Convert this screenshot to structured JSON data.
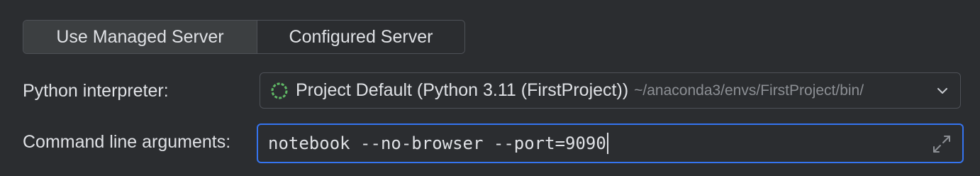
{
  "server_mode": {
    "options": [
      "Use Managed Server",
      "Configured Server"
    ],
    "selected": "Use Managed Server"
  },
  "interpreter": {
    "label": "Python interpreter:",
    "value": "Project Default (Python 3.11 (FirstProject))",
    "path": "~/anaconda3/envs/FirstProject/bin/",
    "icon": "python-env-icon"
  },
  "arguments": {
    "label": "Command line arguments:",
    "value": "notebook --no-browser --port=9090"
  },
  "colors": {
    "background": "#2b2d30",
    "focus_border": "#3574f0",
    "interpreter_icon": "#5fb865"
  }
}
